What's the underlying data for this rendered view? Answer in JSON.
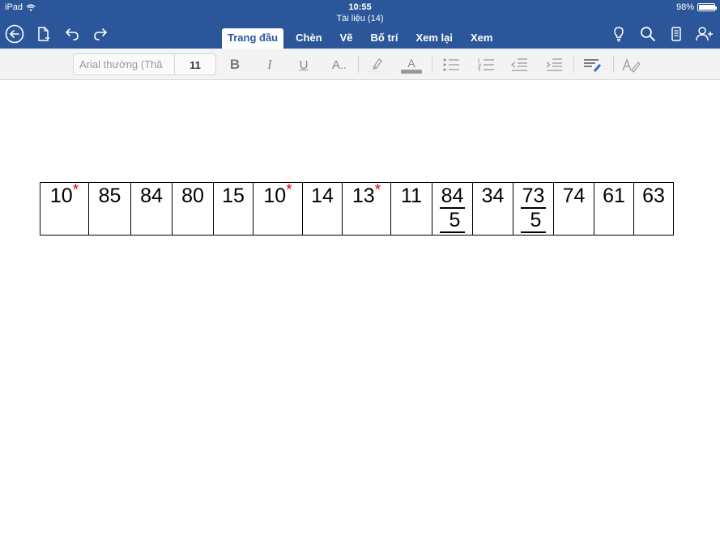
{
  "status_bar": {
    "device": "iPad",
    "time": "10:55",
    "battery": "98%",
    "battery_level": 0.98
  },
  "document": {
    "title": "Tài liệu (14)"
  },
  "tabs": [
    {
      "label": "Trang đầu",
      "active": true
    },
    {
      "label": "Chèn",
      "active": false
    },
    {
      "label": "Vẽ",
      "active": false
    },
    {
      "label": "Bố trí",
      "active": false
    },
    {
      "label": "Xem lại",
      "active": false
    },
    {
      "label": "Xem",
      "active": false
    }
  ],
  "ribbon": {
    "font_name": "Arial thường (Thâ",
    "font_size": "11",
    "bold_label": "B",
    "italic_label": "I",
    "underline_label": "U",
    "text_effects_label": "A..",
    "font_color_label": "A"
  },
  "table": {
    "cells": [
      {
        "value": "10",
        "mark": "*"
      },
      {
        "value": "85"
      },
      {
        "value": "84"
      },
      {
        "value": "80"
      },
      {
        "value": "15"
      },
      {
        "value": "10",
        "mark": "*"
      },
      {
        "value": "14"
      },
      {
        "value": "13",
        "mark": "*"
      },
      {
        "value": "11"
      },
      {
        "numerator": "84",
        "denominator": "5"
      },
      {
        "value": "34"
      },
      {
        "numerator": "73",
        "denominator": "5"
      },
      {
        "value": "74"
      },
      {
        "value": "61"
      },
      {
        "value": "63"
      }
    ]
  },
  "colors": {
    "header_blue": "#2b579a",
    "ribbon_bg": "#f3f3f3",
    "mark_red": "#e00000"
  }
}
